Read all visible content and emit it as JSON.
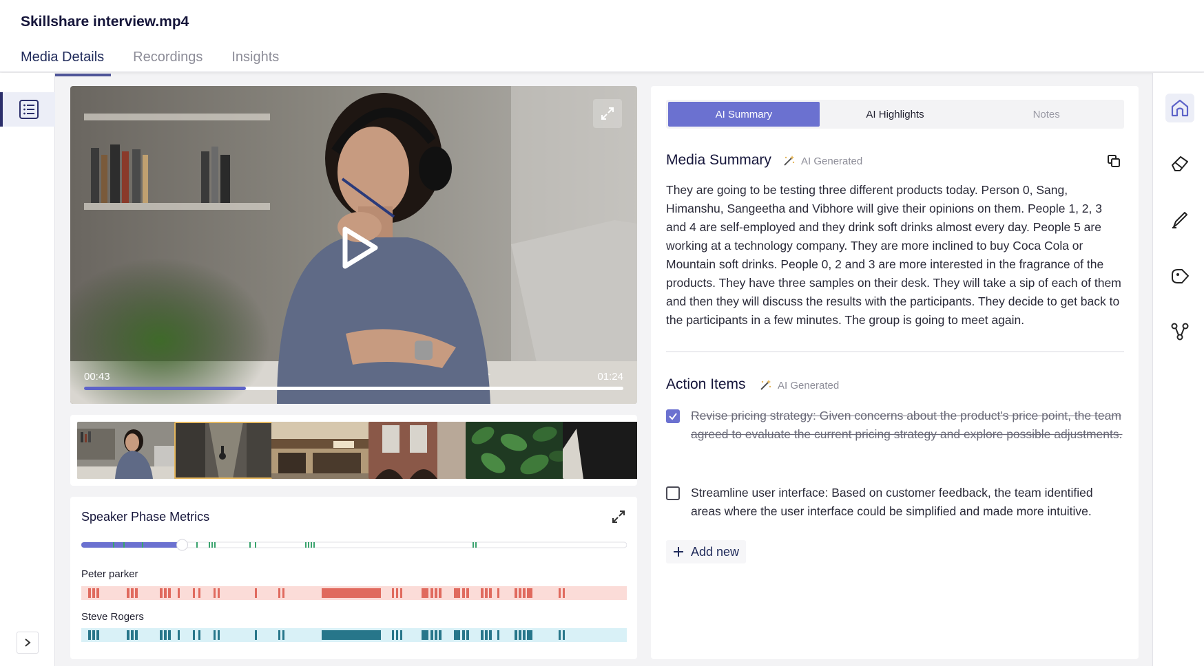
{
  "header": {
    "file_title": "Skillshare interview.mp4",
    "tabs": [
      {
        "label": "Media Details",
        "active": true
      },
      {
        "label": "Recordings",
        "active": false
      },
      {
        "label": "Insights",
        "active": false
      }
    ]
  },
  "video": {
    "current_time": "00:43",
    "total_time": "01:24",
    "progress_fraction": 0.3,
    "colors": {
      "progress": "#5d63c8"
    }
  },
  "thumbnails": [
    {
      "name": "woman-at-laptop",
      "selected": false
    },
    {
      "name": "alley-cyclist",
      "selected": true
    },
    {
      "name": "corner-cafe",
      "selected": false
    },
    {
      "name": "building-facade",
      "selected": false
    },
    {
      "name": "green-leaves",
      "selected": false
    },
    {
      "name": "partial-thumbnail",
      "selected": false
    }
  ],
  "metrics": {
    "title": "Speaker Phase Metrics",
    "scrub_fraction": 0.185,
    "speakers": [
      {
        "name": "Peter parker",
        "color": "#e06a5e",
        "bg": "#fbdcd8"
      },
      {
        "name": "Steve Rogers",
        "color": "#27768a",
        "bg": "#d9f1f7"
      }
    ]
  },
  "panel": {
    "tabs": [
      {
        "label": "AI Summary",
        "active": true
      },
      {
        "label": "AI Highlights",
        "active": false
      },
      {
        "label": "Notes",
        "active": false
      }
    ],
    "summary_title": "Media Summary",
    "ai_tag": "AI Generated",
    "summary_text": "They are going to be testing three different products today. Person 0, Sang, Himanshu, Sangeetha and Vibhore will give their opinions on them. People 1, 2, 3 and 4 are self-employed and they drink soft drinks almost every day. People 5 are working at a technology company. They are more inclined to buy Coca Cola or Mountain soft drinks. People 0, 2 and 3 are more interested in the fragrance of the products. They have three samples on their desk. They will take a sip of each of them and then they will discuss the results with the participants. They decide to get back to the participants in a few minutes. The group is going to meet again.",
    "action_title": "Action Items",
    "action_items": [
      {
        "text": "Revise pricing strategy: Given concerns about the product's price point, the team agreed to evaluate the current pricing strategy and explore possible adjustments.",
        "checked": true
      },
      {
        "text": "Streamline user interface: Based on customer feedback, the team identified areas where the user interface could be simplified and made more intuitive.",
        "checked": false
      }
    ],
    "add_new_label": "Add new"
  },
  "right_rail": [
    "home-icon",
    "eraser-icon",
    "pen-icon",
    "tag-icon",
    "share-nodes-icon"
  ]
}
